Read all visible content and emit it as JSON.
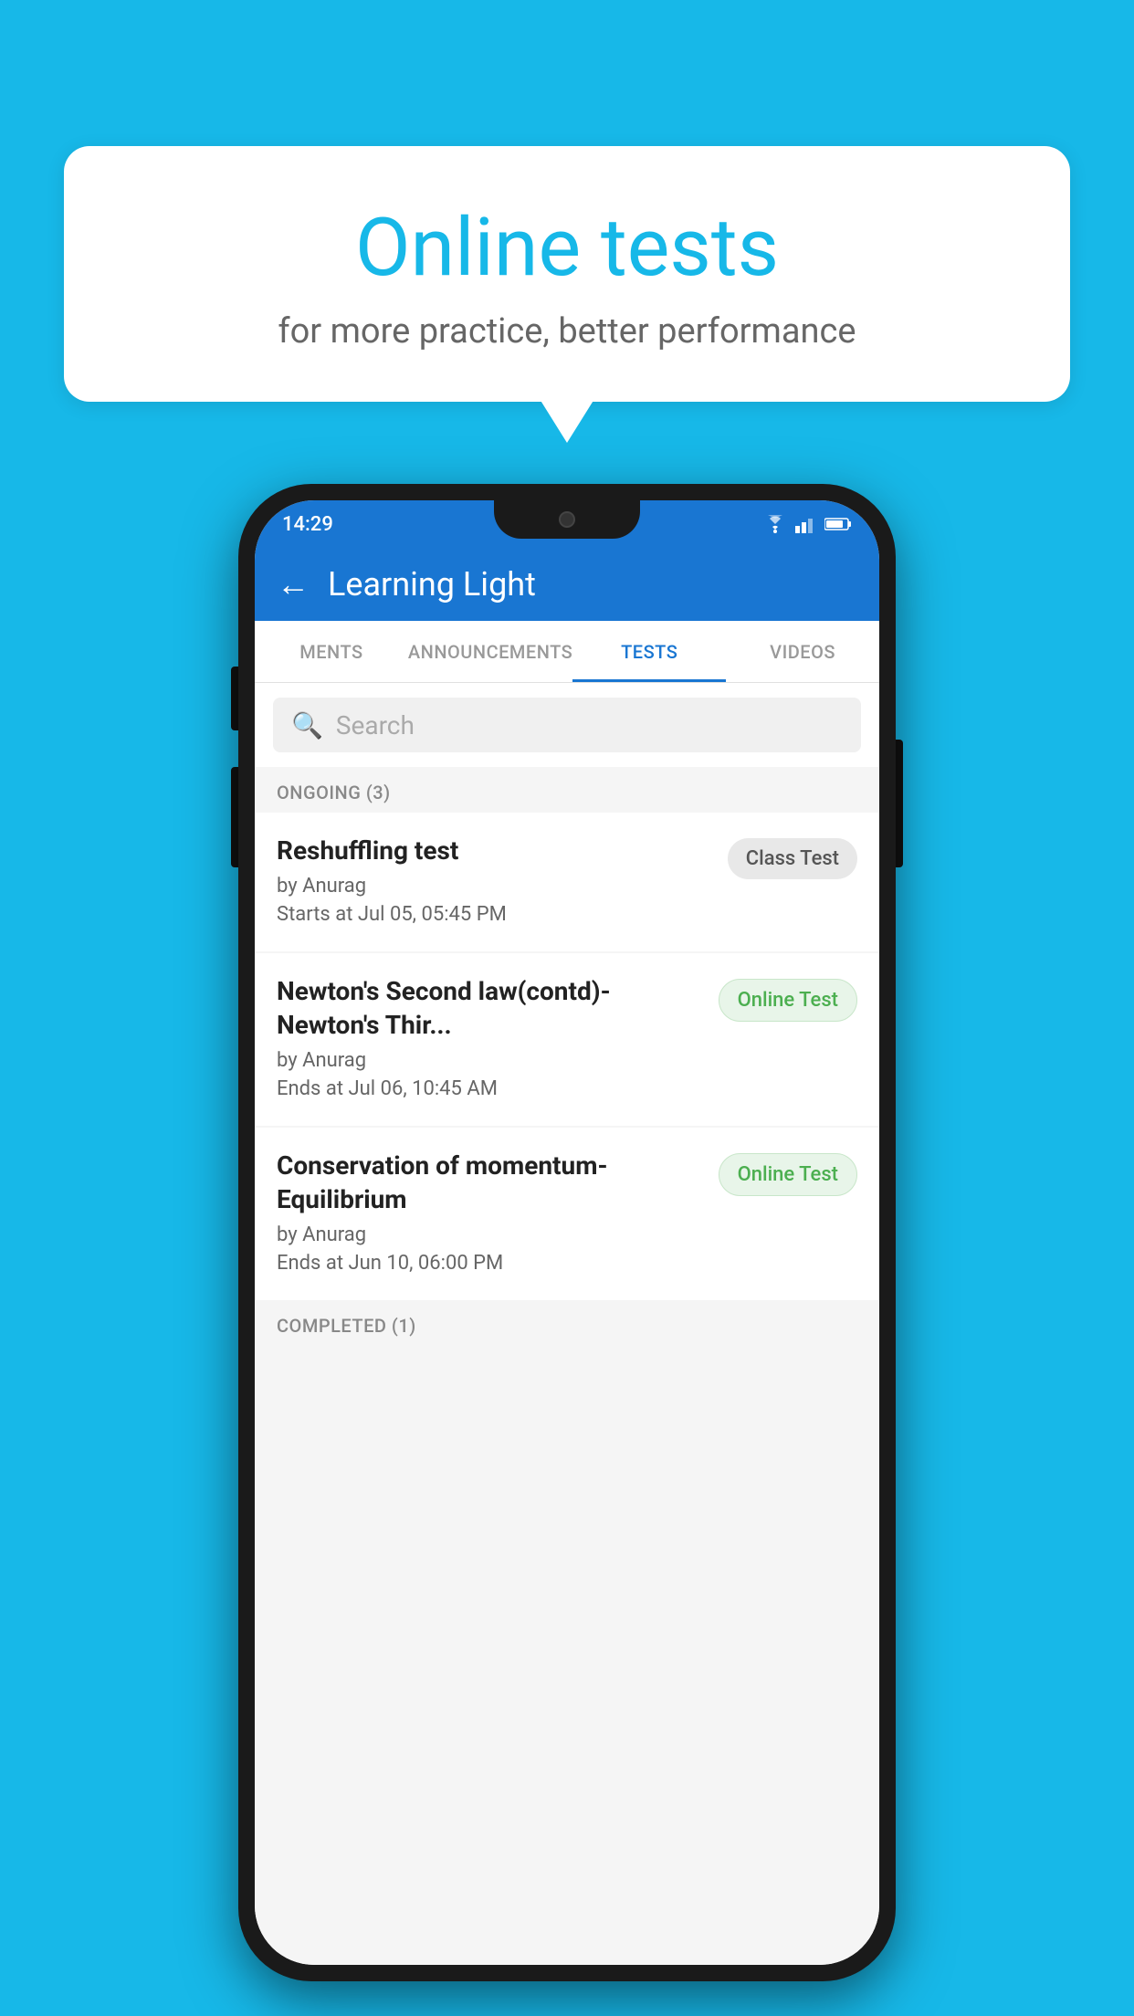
{
  "background": {
    "color": "#17b8e8"
  },
  "speech_bubble": {
    "title": "Online tests",
    "subtitle": "for more practice, better performance"
  },
  "phone": {
    "status_bar": {
      "time": "14:29",
      "icons": [
        "wifi",
        "signal",
        "battery"
      ]
    },
    "header": {
      "back_label": "←",
      "title": "Learning Light"
    },
    "tabs": [
      {
        "label": "MENTS",
        "active": false
      },
      {
        "label": "ANNOUNCEMENTS",
        "active": false
      },
      {
        "label": "TESTS",
        "active": true
      },
      {
        "label": "VIDEOS",
        "active": false
      }
    ],
    "search": {
      "placeholder": "Search"
    },
    "ongoing_section": {
      "header": "ONGOING (3)",
      "items": [
        {
          "title": "Reshuffling test",
          "author": "by Anurag",
          "time_label": "Starts at",
          "time_value": "Jul 05, 05:45 PM",
          "badge": "Class Test",
          "badge_type": "class"
        },
        {
          "title": "Newton's Second law(contd)-Newton's Thir...",
          "author": "by Anurag",
          "time_label": "Ends at",
          "time_value": "Jul 06, 10:45 AM",
          "badge": "Online Test",
          "badge_type": "online"
        },
        {
          "title": "Conservation of momentum-Equilibrium",
          "author": "by Anurag",
          "time_label": "Ends at",
          "time_value": "Jun 10, 06:00 PM",
          "badge": "Online Test",
          "badge_type": "online"
        }
      ]
    },
    "completed_section": {
      "header": "COMPLETED (1)"
    }
  }
}
